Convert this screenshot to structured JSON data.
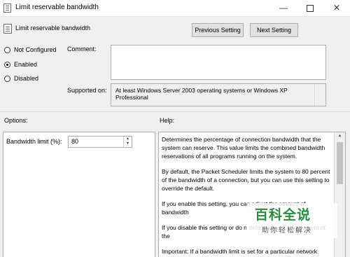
{
  "window": {
    "title": "Limit reservable bandwidth",
    "minimize_glyph": "—",
    "close_glyph": "✕"
  },
  "policy": {
    "title": "Limit reservable bandwidth"
  },
  "nav": {
    "previous_label": "Previous Setting",
    "next_label": "Next Setting"
  },
  "state": {
    "not_configured": "Not Configured",
    "enabled": "Enabled",
    "disabled": "Disabled",
    "selected": "enabled"
  },
  "comment": {
    "label": "Comment:",
    "value": ""
  },
  "supported": {
    "label": "Supported on:",
    "value": "At least Windows Server 2003 operating systems or Windows XP Professional"
  },
  "options": {
    "header": "Options:",
    "bandwidth_label": "Bandwidth limit (%):",
    "bandwidth_value": "80",
    "spin_up": "▲",
    "spin_down": "▼"
  },
  "help": {
    "header": "Help:",
    "paragraphs": [
      "Determines the percentage of connection bandwidth that the system can reserve. This value limits the combined bandwidth reservations of all programs running on the system.",
      "By default, the Packet Scheduler limits the system to 80 percent of the bandwidth of a connection, but you can use this setting to override the default.",
      "If you enable this setting, you can adjust the amount of bandwidth",
      "If you disable this setting or do n default value of 80 percent of the",
      "Important: If a bandwidth limit is set for a particular network"
    ],
    "scroll_up": "▲"
  },
  "watermark": {
    "title": "百科全说",
    "subtitle": "助你轻松解决"
  }
}
